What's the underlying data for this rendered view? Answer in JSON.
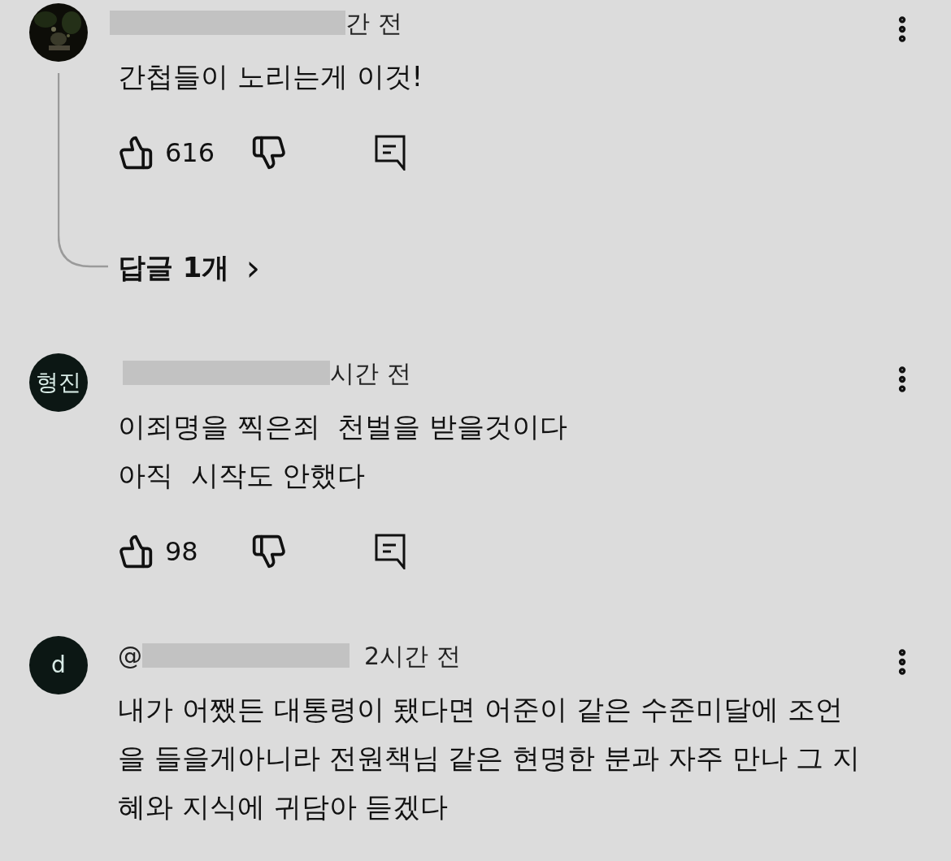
{
  "comments": [
    {
      "time": "간 전",
      "text": "간첩들이 노리는게 이것!",
      "likes": "616",
      "replies": {
        "label": "답글 1개",
        "chevron": "›"
      }
    },
    {
      "avatar": {
        "kind": "initials",
        "text": "형진"
      },
      "time": "시간 전",
      "text": "이죄명을 찍은죄  천벌을 받을것이다\n아직  시작도 안했다",
      "likes": "98"
    },
    {
      "avatar": {
        "kind": "initials",
        "text": "d"
      },
      "author_prefix": "@",
      "time": "2시간 전",
      "text": "내가 어쨌든 대통령이 됐다면 어준이 같은 수준미달에 조언을 들을게아니라 전원책님 같은 현명한 분과 자주 만나 그 지혜와 지식에 귀담아 듣겠다"
    }
  ]
}
